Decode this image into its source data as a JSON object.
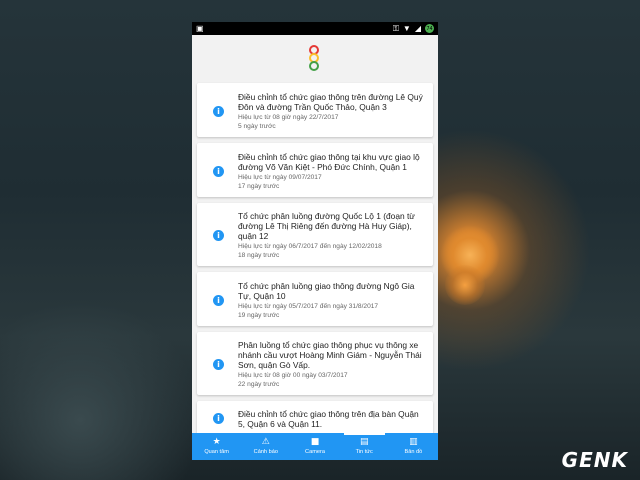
{
  "watermark": "GENK",
  "news": [
    {
      "title": "Điều chỉnh tổ chức giao thông trên đường Lê Quý Đôn và đường Trần Quốc Thảo, Quận 3",
      "meta": "Hiệu lực từ 08 giờ ngày 22/7/2017",
      "ago": "5 ngày trước"
    },
    {
      "title": "Điều chỉnh tổ chức giao thông tại khu vực giao lộ đường Võ Văn Kiệt - Phó Đức Chính, Quận 1",
      "meta": "Hiệu lực từ ngày 09/07/2017",
      "ago": "17 ngày trước"
    },
    {
      "title": "Tổ chức phân luồng đường Quốc Lộ 1 (đoạn từ đường Lê Thị Riêng đến đường Hà Huy Giáp), quận 12",
      "meta": "Hiệu lực từ ngày 06/7/2017 đến ngày 12/02/2018",
      "ago": "18 ngày trước"
    },
    {
      "title": "Tổ chức phân luồng giao thông đường Ngô Gia Tự, Quận 10",
      "meta": "Hiệu lực từ ngày 05/7/2017 đến ngày 31/8/2017",
      "ago": "19 ngày trước"
    },
    {
      "title": "Phân luồng tổ chức giao thông phục vụ thông xe nhánh cầu vượt Hoàng Minh Giám - Nguyễn Thái Sơn, quận Gò Vấp.",
      "meta": "Hiệu lực từ 08 giờ 00 ngày 03/7/2017",
      "ago": "22 ngày trước"
    },
    {
      "title": "Điều chỉnh tổ chức giao thông trên địa bàn Quận 5, Quận 6 và Quận 11.",
      "meta": "",
      "ago": ""
    }
  ],
  "nav": [
    {
      "label": "Quan tâm",
      "icon": "star-icon",
      "glyph": "★"
    },
    {
      "label": "Cảnh báo",
      "icon": "warning-icon",
      "glyph": "⚠"
    },
    {
      "label": "Camera",
      "icon": "camera-icon",
      "glyph": "■"
    },
    {
      "label": "Tin tức",
      "icon": "news-icon",
      "glyph": "▤"
    },
    {
      "label": "Bản đồ",
      "icon": "map-icon",
      "glyph": "▥"
    }
  ],
  "active_nav": "Tin tức",
  "colors": {
    "accent": "#2196f3",
    "logo_red": "#e53935",
    "logo_yellow": "#fbc02d",
    "logo_green": "#43a047"
  }
}
